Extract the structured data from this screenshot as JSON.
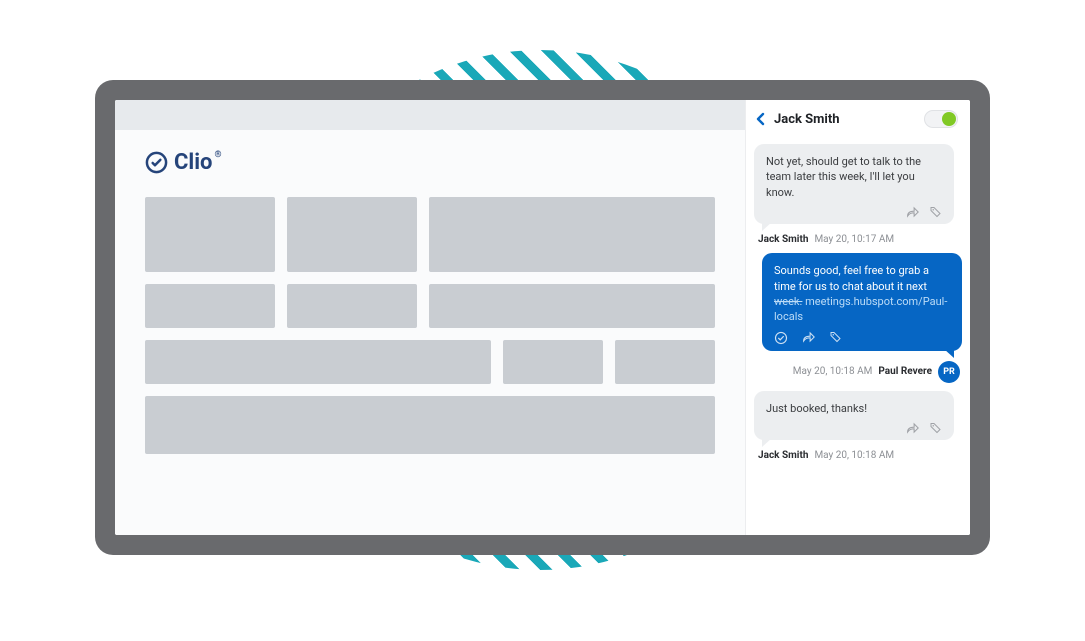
{
  "brand": {
    "name": "Clio"
  },
  "chat": {
    "contact_name": "Jack Smith",
    "toggle_on": true,
    "messages": [
      {
        "direction": "incoming",
        "text": "Not yet, should get to talk to the team later this week, I'll let you know.",
        "sender_name": "Jack Smith",
        "timestamp": "May 20, 10:17 AM"
      },
      {
        "direction": "outgoing",
        "text": "Sounds good, feel free to grab a time for us to chat about it next week.",
        "link_struck": "week.",
        "link_text": "meetings.hubspot.com/Paul-locals",
        "sender_name": "Paul Revere",
        "sender_initials": "PR",
        "timestamp": "May 20, 10:18 AM"
      },
      {
        "direction": "incoming",
        "text": "Just booked, thanks!",
        "sender_name": "Jack Smith",
        "timestamp": "May 20, 10:18 AM"
      }
    ]
  }
}
